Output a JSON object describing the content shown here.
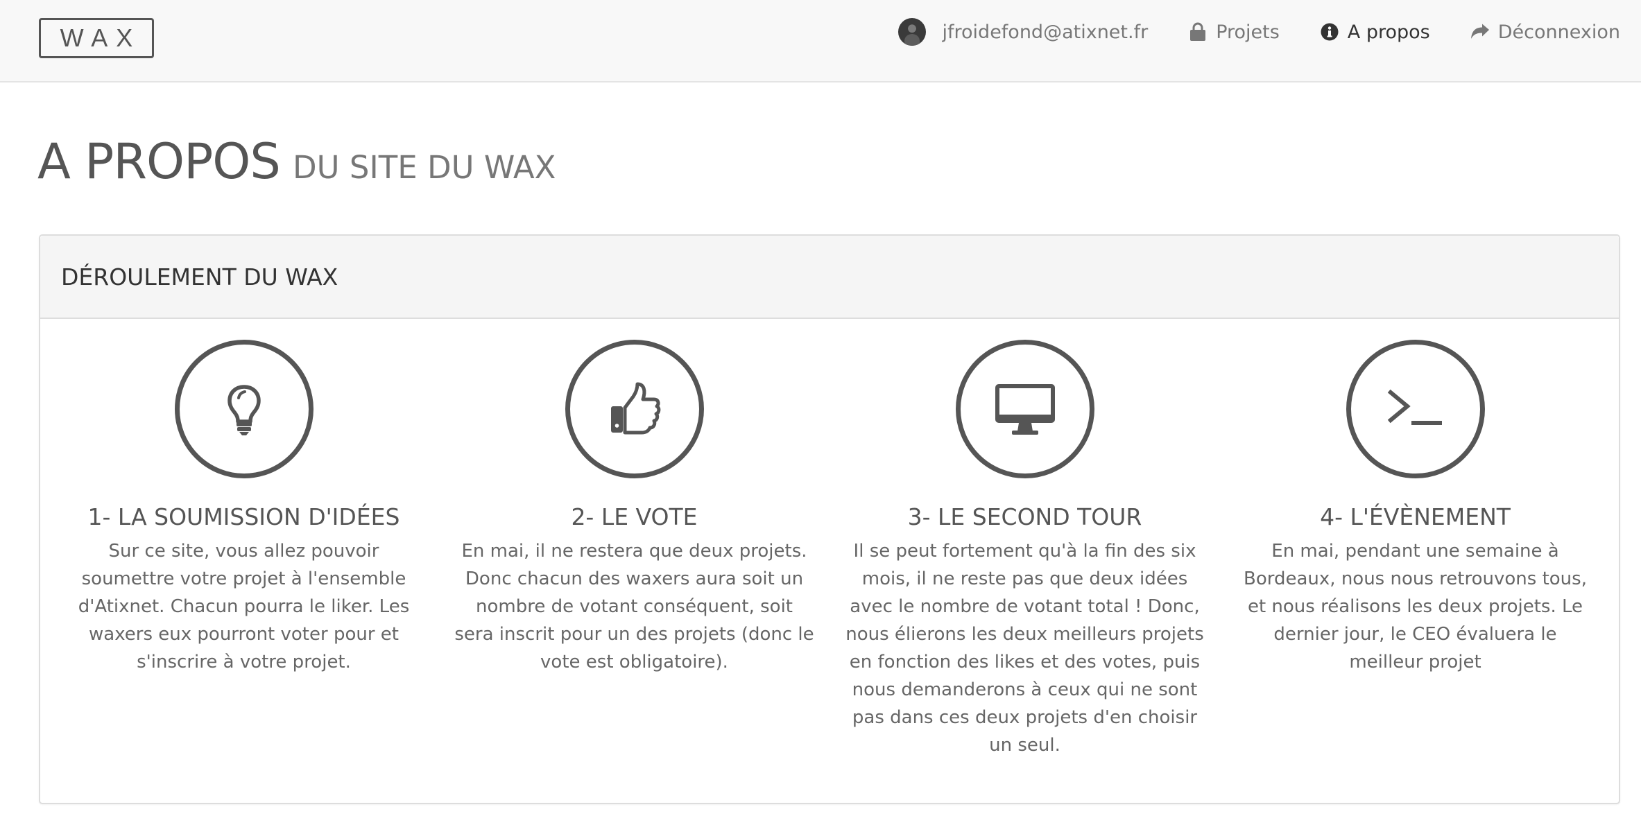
{
  "navbar": {
    "brand": "WAX",
    "user_email": "jfroidefond@atixnet.fr",
    "items": [
      {
        "label": "Projets",
        "icon": "lock-icon"
      },
      {
        "label": "A propos",
        "icon": "info-icon",
        "active": true
      },
      {
        "label": "Déconnexion",
        "icon": "share-arrow-icon"
      }
    ]
  },
  "page": {
    "title": "A PROPOS",
    "subtitle": "DU SITE DU WAX"
  },
  "panel": {
    "heading": "DÉROULEMENT DU WAX",
    "steps": [
      {
        "icon": "lightbulb-icon",
        "title": "1- LA SOUMISSION D'IDÉES",
        "text": "Sur ce site, vous allez pouvoir soumettre votre projet à l'ensemble d'Atixnet. Chacun pourra le liker. Les waxers eux pourront voter pour et s'inscrire à votre projet."
      },
      {
        "icon": "thumbs-up-icon",
        "title": "2- LE VOTE",
        "text": "En mai, il ne restera que deux projets. Donc chacun des waxers aura soit un nombre de votant conséquent, soit sera inscrit pour un des projets (donc le vote est obligatoire)."
      },
      {
        "icon": "monitor-icon",
        "title": "3- LE SECOND TOUR",
        "text": "Il se peut fortement qu'à la fin des six mois, il ne reste pas que deux idées avec le nombre de votant total ! Donc, nous élierons les deux meilleurs projets en fonction des likes et des votes, puis nous demanderons à ceux qui ne sont pas dans ces deux projets d'en choisir un seul."
      },
      {
        "icon": "terminal-icon",
        "title": "4- L'ÉVÈNEMENT",
        "text": "En mai, pendant une semaine à Bordeaux, nous nous retrouvons tous, et nous réalisons les deux projets. Le dernier jour, le CEO évaluera le meilleur projet"
      }
    ]
  }
}
